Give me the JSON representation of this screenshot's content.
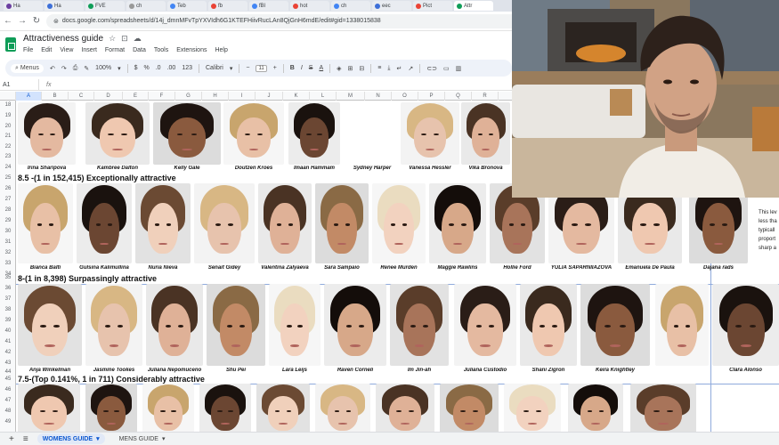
{
  "browser": {
    "tabs": [
      {
        "label": "Ha",
        "color": "#6b3fa0"
      },
      {
        "label": "Ha",
        "color": "#3d6fd8"
      },
      {
        "label": "FVE",
        "color": "#0f9d58"
      },
      {
        "label": "ch",
        "color": "#999999"
      },
      {
        "label": "Teb",
        "color": "#4285f4"
      },
      {
        "label": "fb",
        "color": "#ea4335"
      },
      {
        "label": "fBl",
        "color": "#4285f4"
      },
      {
        "label": "hot",
        "color": "#ea4335"
      },
      {
        "label": "ch",
        "color": "#4285f4"
      },
      {
        "label": "eec",
        "color": "#3d6fd8"
      },
      {
        "label": "Pict",
        "color": "#ea4335"
      },
      {
        "label": "Attr",
        "color": "#0f9d58"
      }
    ],
    "url": "docs.google.com/spreadsheets/d/14j_dmnMFvTpYXVIdh6G1KTEFHiivRucLAn8QjGnH6mdE/edit#gid=1338015838"
  },
  "doc": {
    "title": "Attractiveness guide",
    "menus": [
      "File",
      "Edit",
      "View",
      "Insert",
      "Format",
      "Data",
      "Tools",
      "Extensions",
      "Help"
    ]
  },
  "toolbar": {
    "menus_label": "Menus",
    "zoom": "100%",
    "currency": "$",
    "percent": "%",
    "dec_dec": ".0",
    "dec_inc": ".00",
    "format_123": "123",
    "font": "Calibri",
    "font_size": "11"
  },
  "formula": {
    "cell": "A1",
    "fx": "fx"
  },
  "columns": [
    "A",
    "B",
    "C",
    "D",
    "E",
    "F",
    "G",
    "H",
    "I",
    "J",
    "K",
    "L",
    "M",
    "N",
    "O",
    "P",
    "Q",
    "R"
  ],
  "rows": [
    "18",
    "19",
    "20",
    "21",
    "22",
    "23",
    "24",
    "25",
    "26",
    "27",
    "28",
    "29",
    "30",
    "31",
    "32",
    "33",
    "34",
    "35",
    "36",
    "37",
    "38",
    "39",
    "40",
    "41",
    "42",
    "43",
    "44",
    "45",
    "46",
    "47",
    "48",
    "49"
  ],
  "sections": [
    "8.5 -(1 in 152,415) Exceptionally attractive",
    "8-(1 in 8,398) Surpassingly attractive",
    "7.5-(Top 0.141%, 1 in 711) Considerably attractive"
  ],
  "row1_names": [
    "Irina Sharipova",
    "Kambree Dalton",
    "Kelly Gale",
    "Doutzen Kroes",
    "Imaan Hammam",
    "Sydney Harper",
    "Vanessa Hessler",
    "Vika Bronova"
  ],
  "row2_names": [
    "Bianca Balti",
    "Gulsina Kalimullina",
    "Nuria Nieva",
    "Senait Gidey",
    "Valentina Zalyaeva",
    "Sara Sampaio",
    "Renee Murden",
    "Maggie Rawlins",
    "Hollie Ford",
    "YULIA SAPARNIIAZOVA",
    "Emanuela De Paula",
    "Dajana rads"
  ],
  "row3_names": [
    "Anja Winkelman",
    "Jasmine Tookes",
    "Juliana Nepomuceno",
    "Shu Pei",
    "Lara Leijs",
    "Raven Corneli",
    "Im Jin-ah",
    "Juliana Custodio",
    "Shani Zigron",
    "Keira Knightley",
    "Clara Alonso"
  ],
  "sidenote": [
    "This lev",
    "less tha",
    "typicall",
    "proport",
    "sharp a"
  ],
  "sheets": {
    "add": "+",
    "list": "≡",
    "active": "WOMENS GUIDE",
    "other": "MENS GUIDE",
    "caret": "▾"
  }
}
